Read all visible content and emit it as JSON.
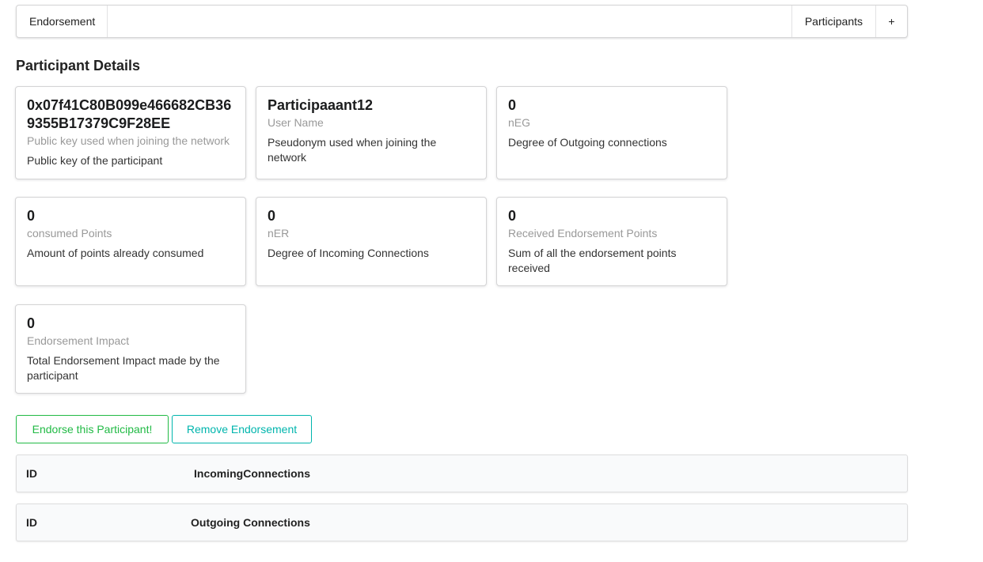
{
  "menu": {
    "brand": "Endorsement",
    "participants": "Participants",
    "add": "+"
  },
  "page_title": "Participant Details",
  "cards": {
    "public_key": {
      "header": "0x07f41C80B099e466682CB369355B17379C9F28EE",
      "meta": "Public key used when joining the network",
      "description": "Public key of the participant"
    },
    "user_name": {
      "header": "Participaaant12",
      "meta": "User Name",
      "description": "Pseudonym used when joining the network"
    },
    "neg": {
      "header": "0",
      "meta": "nEG",
      "description": "Degree of Outgoing connections"
    },
    "consumed_points": {
      "header": "0",
      "meta": "consumed Points",
      "description": "Amount of points already consumed"
    },
    "ner": {
      "header": "0",
      "meta": "nER",
      "description": "Degree of Incoming Connections"
    },
    "received_points": {
      "header": "0",
      "meta": "Received Endorsement Points",
      "description": "Sum of all the endorsement points received"
    },
    "impact": {
      "header": "0",
      "meta": "Endorsement Impact",
      "description": "Total Endorsement Impact made by the participant"
    }
  },
  "buttons": {
    "endorse": "Endorse this Participant!",
    "remove": "Remove Endorsement"
  },
  "incoming_table": {
    "col_id": "ID",
    "col_connections": "IncomingConnections"
  },
  "outgoing_table": {
    "col_id": "ID",
    "col_connections": "Outgoing Connections"
  },
  "colors": {
    "endorse_button": "#21ba45",
    "remove_button": "#00b5ad"
  }
}
